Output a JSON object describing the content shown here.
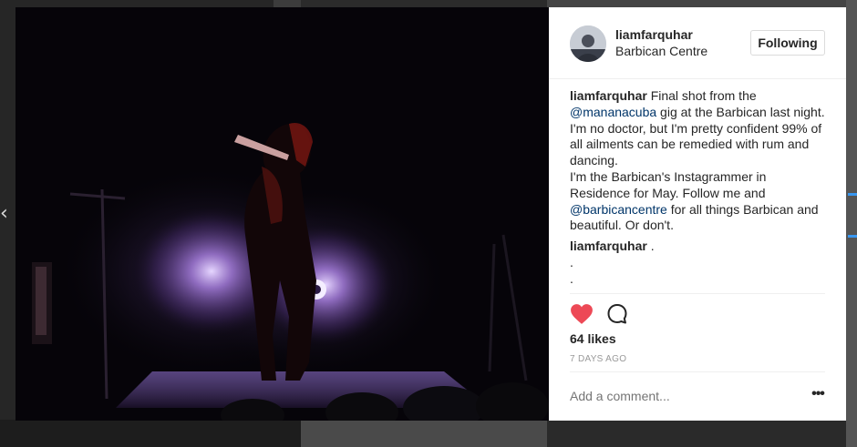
{
  "post": {
    "username": "liamfarquhar",
    "location": "Barbican Centre",
    "follow_label": "Following",
    "caption": {
      "author": "liamfarquhar",
      "text_before_mention": " Final shot from the ",
      "mention1": "@mananacuba",
      "text_after_mention1": " gig at the Barbican last night. I'm no doctor, but I'm pretty confident 99% of all ailments can be remedied with rum and dancing.",
      "line2": "I'm the Barbican's Instagrammer in Residence for May. Follow me and ",
      "mention2": "@barbicancentre",
      "text_after_mention2": " for all things Barbican and beautiful. Or don't."
    },
    "comment2": {
      "author": "liamfarquhar",
      "text": " .",
      "line2": ".",
      "line3": "."
    },
    "likes": "64 likes",
    "timestamp": "7 DAYS AGO",
    "add_comment_placeholder": "Add a comment...",
    "more_label": "•••"
  },
  "nav": {
    "prev_glyph": "‹"
  },
  "colors": {
    "like": "#ed4956",
    "mention": "#003569",
    "muted": "#999999"
  },
  "icons": [
    "heart-icon",
    "comment-icon",
    "more-options-icon",
    "chevron-left-icon"
  ]
}
